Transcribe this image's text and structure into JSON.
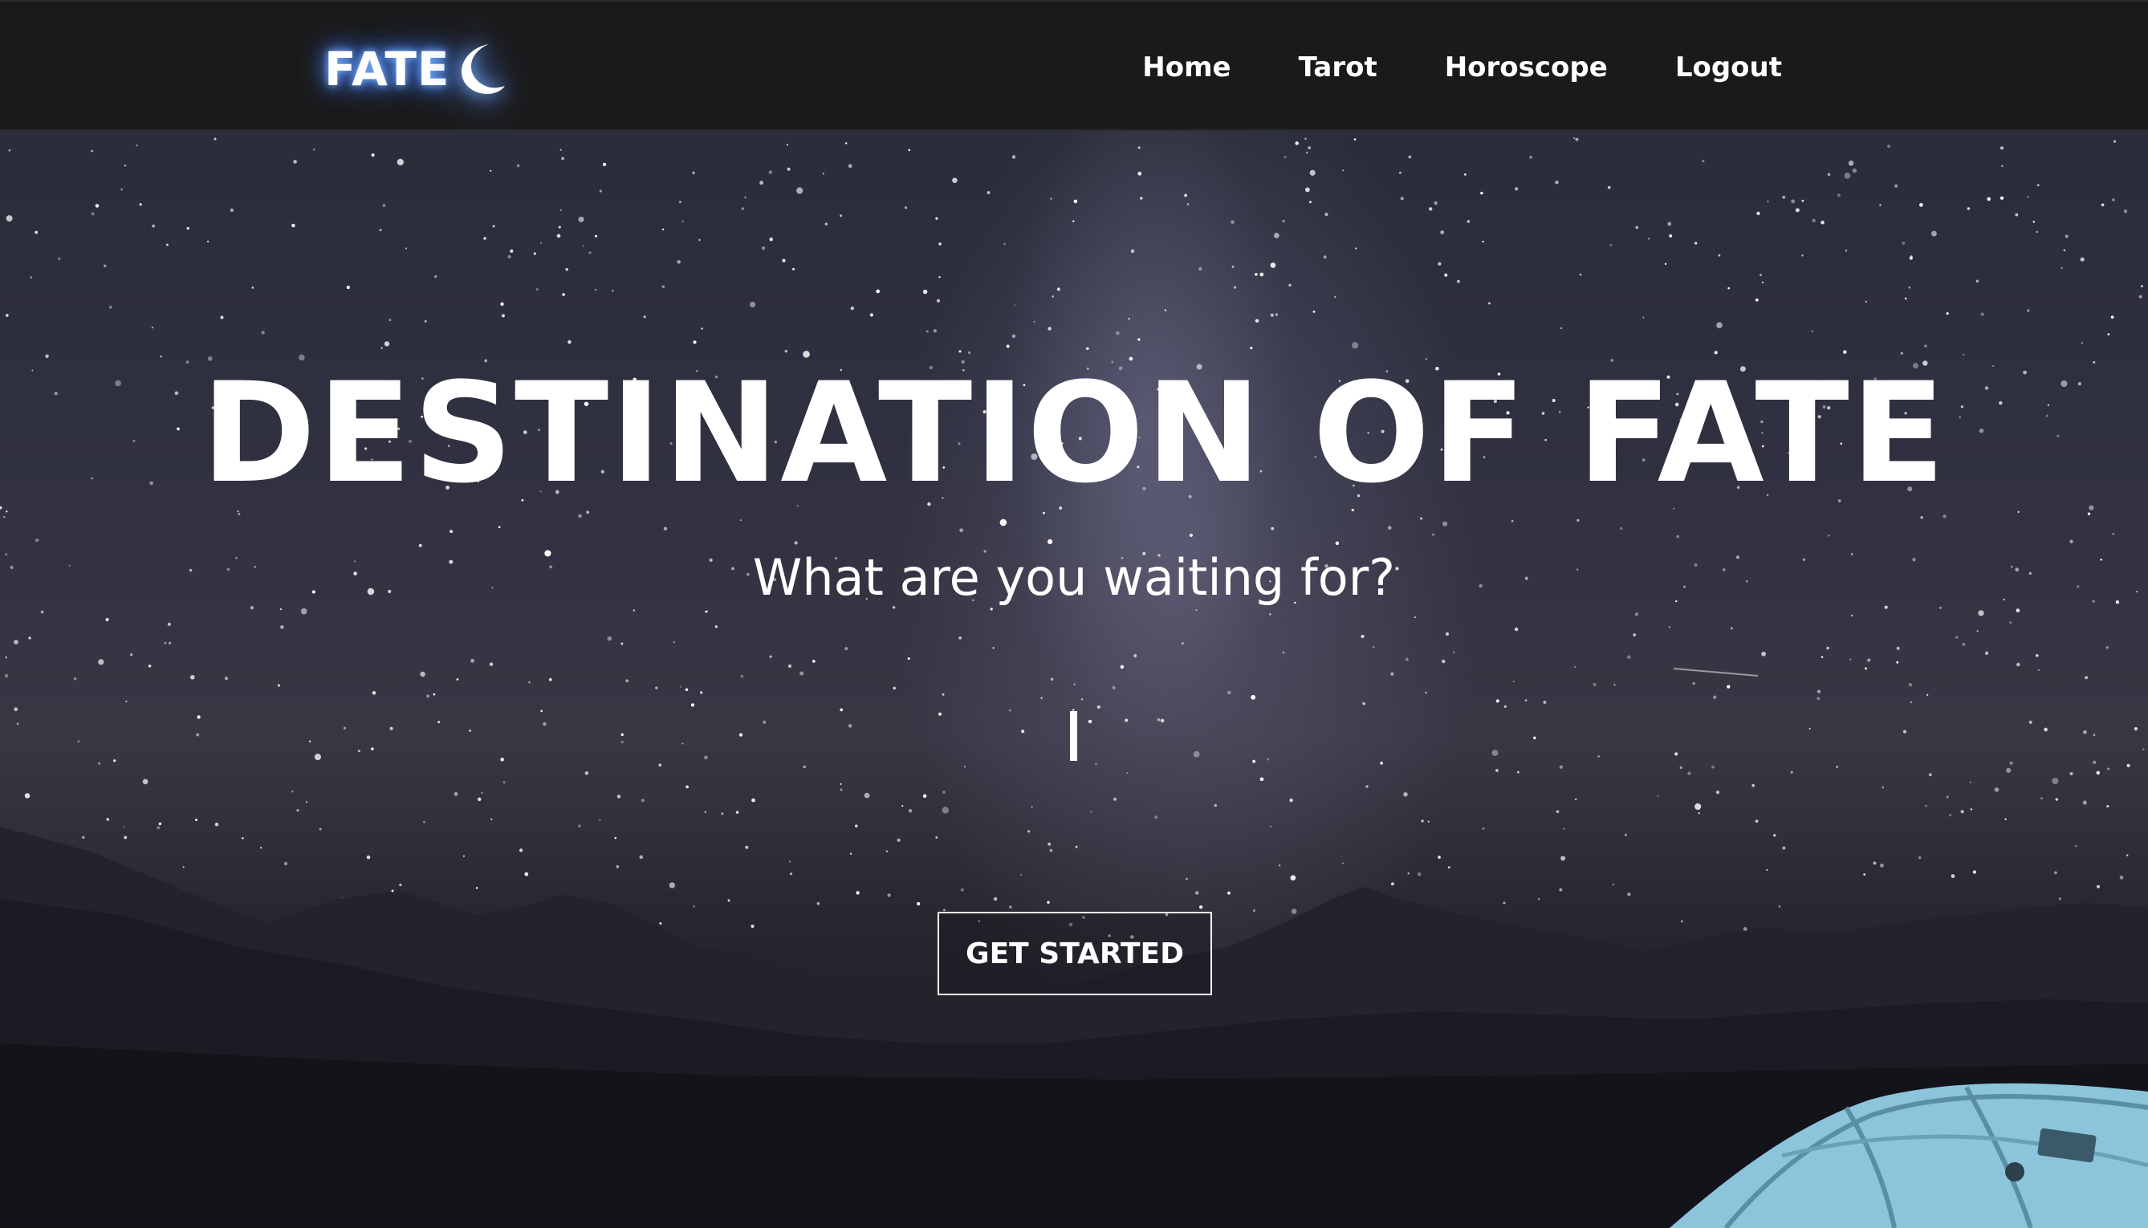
{
  "nav": {
    "logo_text": "FATE",
    "logo_icon": "crescent-moon-icon",
    "links": [
      {
        "label": "Home"
      },
      {
        "label": "Tarot"
      },
      {
        "label": "Horoscope"
      },
      {
        "label": "Logout"
      }
    ]
  },
  "hero": {
    "title": "DESTINATION OF FATE",
    "subtitle": "What are you waiting for?",
    "cta_label": "GET STARTED"
  },
  "colors": {
    "nav_background": "#1b1a1b",
    "text": "#ffffff",
    "logo_glow": "#4d8cff",
    "sky": "#2f3040",
    "tent": "#9ad0e8"
  }
}
